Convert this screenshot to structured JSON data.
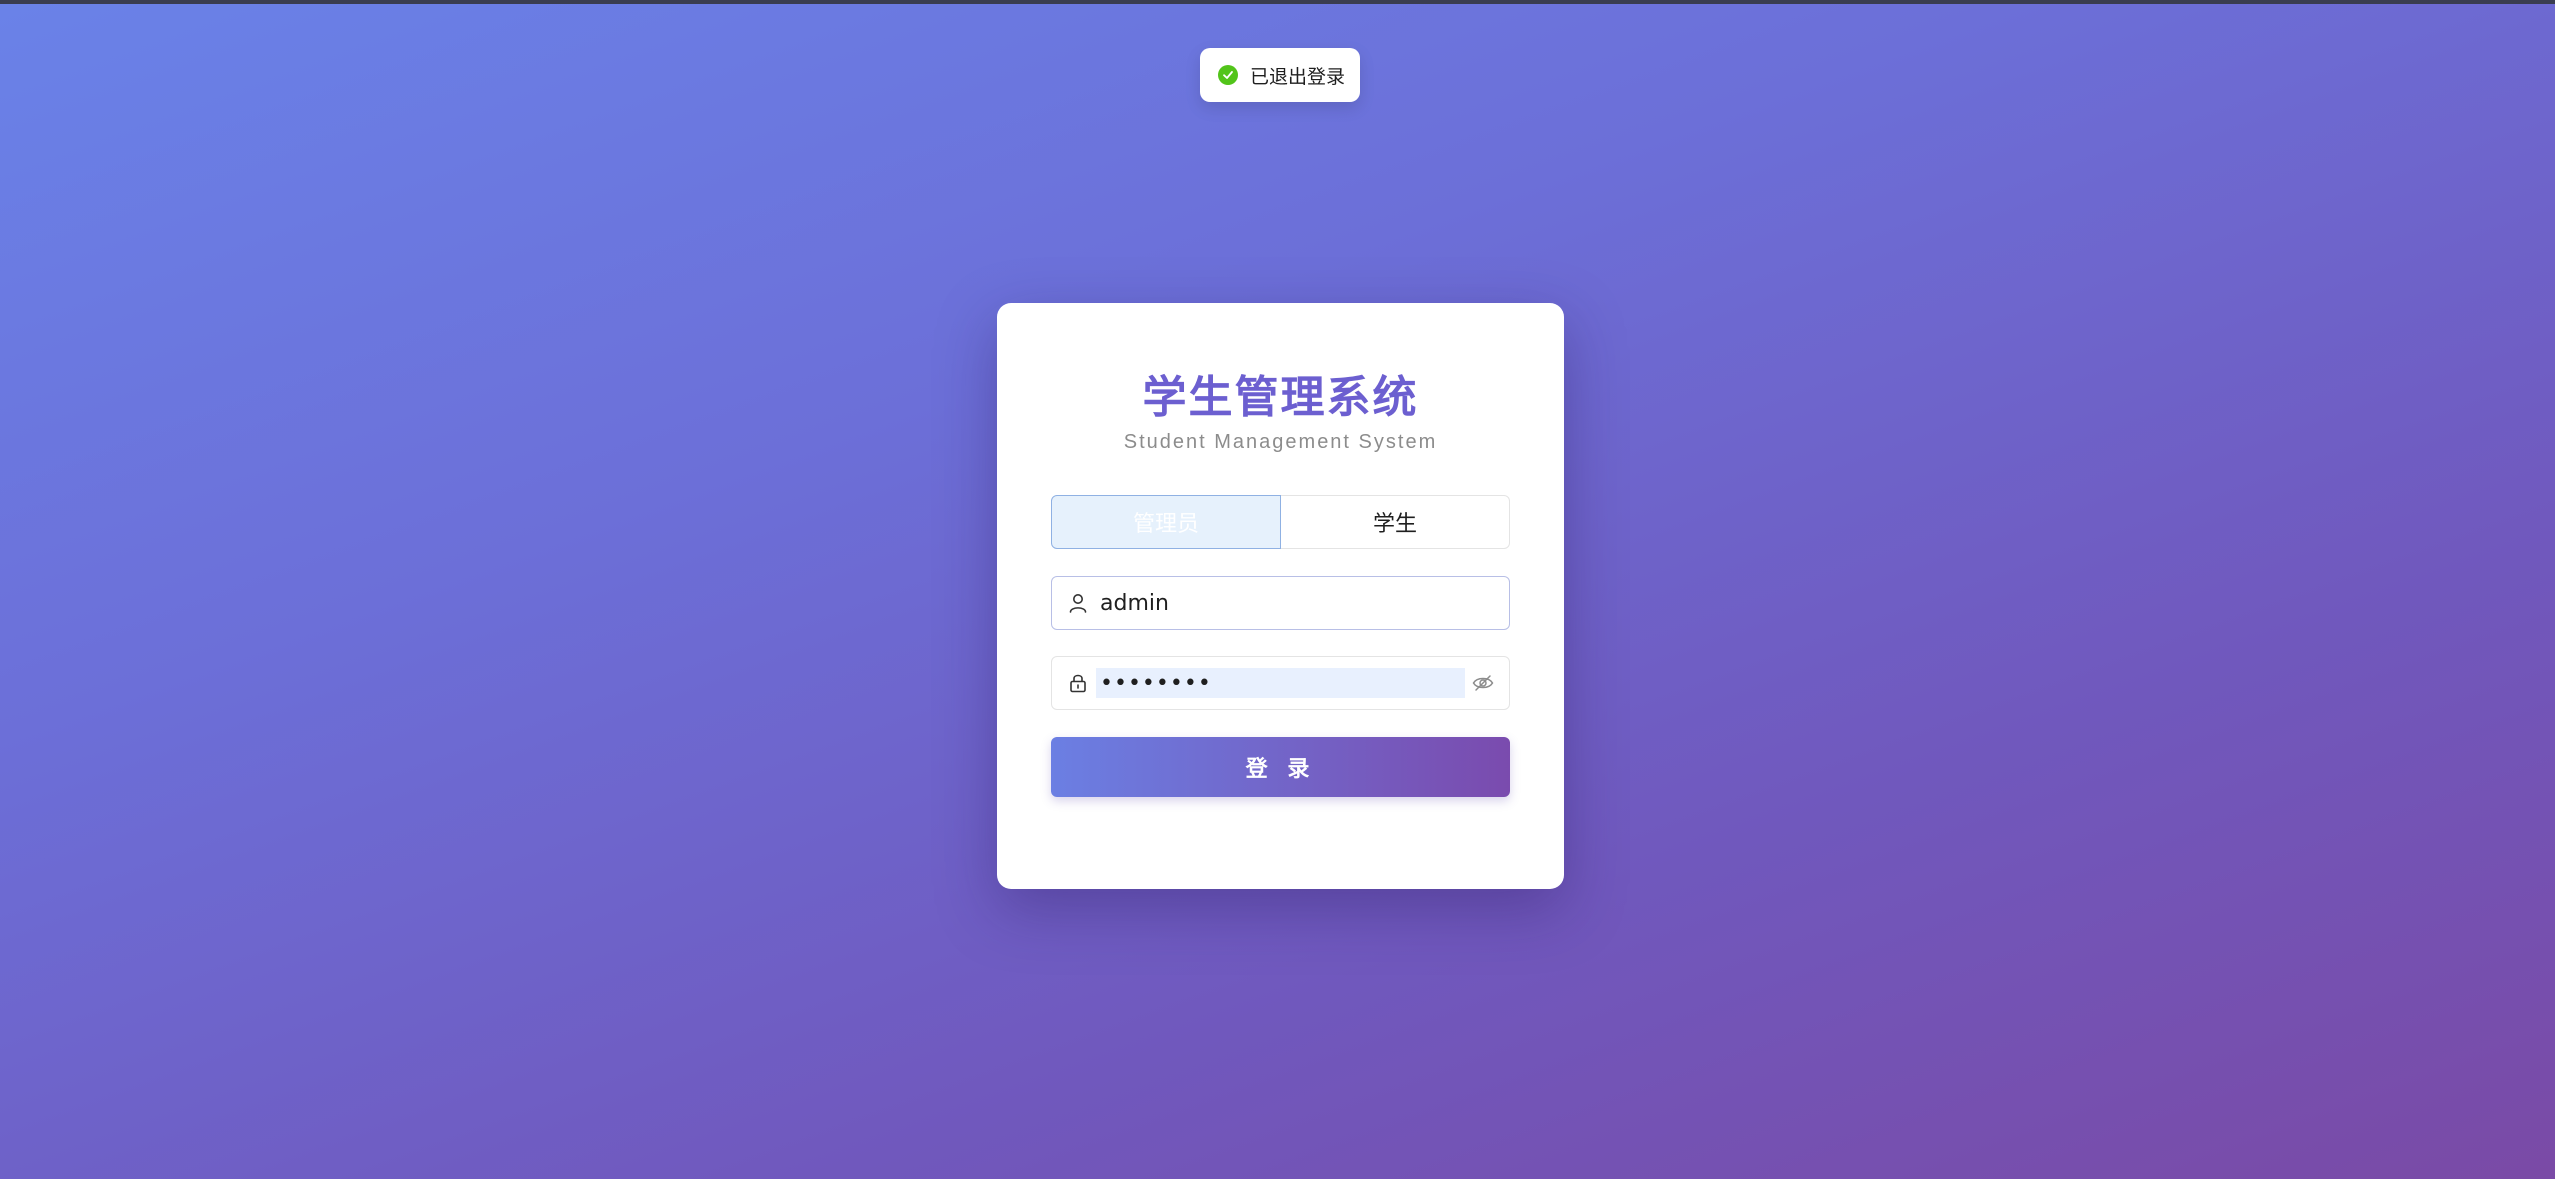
{
  "toast": {
    "message": "已退出登录",
    "icon": "check-circle-icon",
    "color": "#52c41a"
  },
  "login": {
    "title": "学生管理系统",
    "subtitle": "Student Management System",
    "roles": [
      {
        "label": "管理员",
        "selected": true
      },
      {
        "label": "学生",
        "selected": false
      }
    ],
    "username": {
      "value": "admin",
      "icon": "user-icon"
    },
    "password": {
      "value": "12345678",
      "icon": "lock-icon",
      "toggle_icon": "eye-off-icon"
    },
    "submit_label": "登 录"
  },
  "colors": {
    "accent": "#6c5fd0",
    "gradient_start": "#6b7fe3",
    "gradient_end": "#7a4bae"
  }
}
